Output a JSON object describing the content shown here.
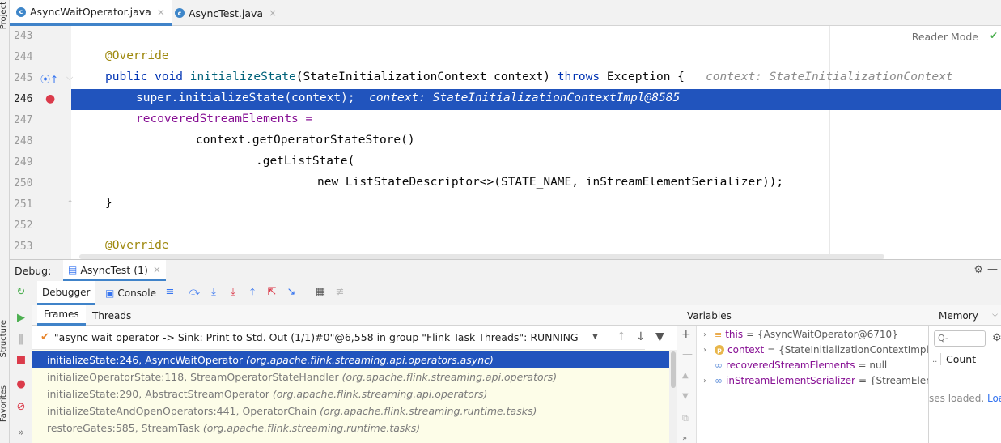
{
  "side_strip": {
    "project_label": "Project",
    "structure_label": "Structure",
    "favorites_label": "Favorites"
  },
  "editor_tabs": [
    {
      "label": "AsyncWaitOperator.java",
      "active": true,
      "icon": "java-class-icon"
    },
    {
      "label": "AsyncTest.java",
      "active": false,
      "icon": "java-class-icon"
    }
  ],
  "editor": {
    "reader_mode": "Reader Mode",
    "lines": [
      {
        "num": "243",
        "code": ""
      },
      {
        "num": "244",
        "code": "@Override"
      },
      {
        "num": "245",
        "code": "public void initializeState(StateInitializationContext context) throws Exception {",
        "hint": "context: StateInitializationContext"
      },
      {
        "num": "246",
        "code": "super.initializeState(context);",
        "hint": "context: StateInitializationContextImpl@8585"
      },
      {
        "num": "247",
        "code": "recoveredStreamElements ="
      },
      {
        "num": "248",
        "code": "context.getOperatorStateStore()"
      },
      {
        "num": "249",
        "code": ".getListState("
      },
      {
        "num": "250",
        "code": "new ListStateDescriptor<>(STATE_NAME, inStreamElementSerializer));"
      },
      {
        "num": "251",
        "code": "}"
      },
      {
        "num": "252",
        "code": ""
      },
      {
        "num": "253",
        "code": "@Override"
      }
    ]
  },
  "debug": {
    "label": "Debug:",
    "session_tab": "AsyncTest (1)",
    "toolbar": {
      "debugger_tab": "Debugger",
      "console_tab": "Console"
    },
    "frames": {
      "tabs": [
        "Frames",
        "Threads"
      ],
      "thread": "\"async wait operator -> Sink: Print to Std. Out (1/1)#0\"@6,558 in group \"Flink Task Threads\": RUNNING",
      "items": [
        {
          "method": "initializeState:246, AsyncWaitOperator",
          "pkg": "(org.apache.flink.streaming.api.operators.async)"
        },
        {
          "method": "initializeOperatorState:118, StreamOperatorStateHandler",
          "pkg": "(org.apache.flink.streaming.api.operators)"
        },
        {
          "method": "initializeState:290, AbstractStreamOperator",
          "pkg": "(org.apache.flink.streaming.api.operators)"
        },
        {
          "method": "initializeStateAndOpenOperators:441, OperatorChain",
          "pkg": "(org.apache.flink.streaming.runtime.tasks)"
        },
        {
          "method": "restoreGates:585, StreamTask",
          "pkg": "(org.apache.flink.streaming.runtime.tasks)"
        }
      ]
    },
    "variables": {
      "title": "Variables",
      "items": [
        {
          "name": "this",
          "value": "= {AsyncWaitOperator@6710}",
          "icon": "field-icon"
        },
        {
          "name": "context",
          "value": "= {StateInitializationContextImpl@",
          "icon": "parameter-icon"
        },
        {
          "name": "recoveredStreamElements",
          "value": "= null",
          "icon": "watch-icon"
        },
        {
          "name": "inStreamElementSerializer",
          "value": "= {StreamEleme",
          "icon": "watch-icon"
        }
      ]
    },
    "memory": {
      "title": "Memory",
      "search_placeholder": "Q-",
      "count_header": "Count",
      "classes_note": "ses loaded.",
      "load_link": "Loa"
    }
  }
}
